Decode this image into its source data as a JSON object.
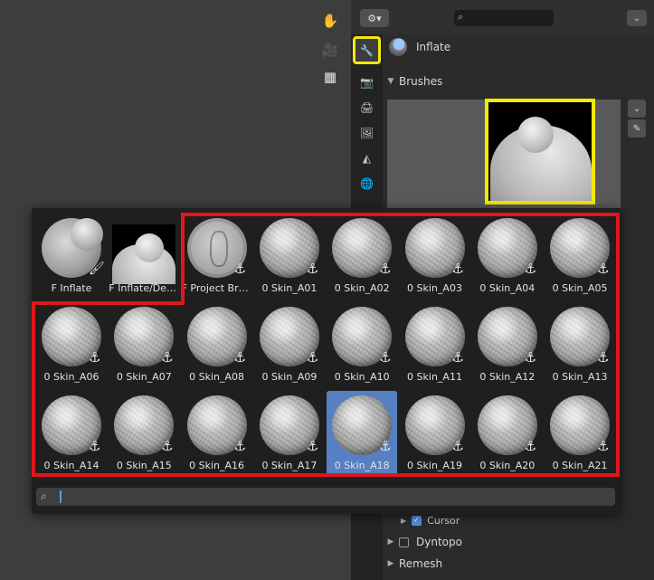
{
  "properties": {
    "brush_name": "Inflate",
    "brushes_panel_title": "Brushes",
    "panels": [
      {
        "label": "Cursor",
        "checked": true
      },
      {
        "label": "Dyntopo",
        "checked": false
      },
      {
        "label": "Remesh"
      }
    ]
  },
  "popup": {
    "items": [
      {
        "label": "F Inflate",
        "icon": "paint-brush-icon",
        "thumb": "inflate"
      },
      {
        "label": "F Inflate/Defl...",
        "icon": "",
        "thumb": "square"
      },
      {
        "label": "F Project Bru...",
        "icon": "anchor-icon",
        "thumb": "coin"
      },
      {
        "label": "0 Skin_A01",
        "icon": "anchor-icon",
        "thumb": "sphere"
      },
      {
        "label": "0 Skin_A02",
        "icon": "anchor-icon",
        "thumb": "sphere"
      },
      {
        "label": "0 Skin_A03",
        "icon": "anchor-icon",
        "thumb": "sphere"
      },
      {
        "label": "0 Skin_A04",
        "icon": "anchor-icon",
        "thumb": "sphere"
      },
      {
        "label": "0 Skin_A05",
        "icon": "anchor-icon",
        "thumb": "sphere"
      },
      {
        "label": "0 Skin_A06",
        "icon": "anchor-icon",
        "thumb": "sphere"
      },
      {
        "label": "0 Skin_A07",
        "icon": "anchor-icon",
        "thumb": "sphere"
      },
      {
        "label": "0 Skin_A08",
        "icon": "anchor-icon",
        "thumb": "sphere"
      },
      {
        "label": "0 Skin_A09",
        "icon": "anchor-icon",
        "thumb": "sphere"
      },
      {
        "label": "0 Skin_A10",
        "icon": "anchor-icon",
        "thumb": "sphere"
      },
      {
        "label": "0 Skin_A11",
        "icon": "anchor-icon",
        "thumb": "sphere"
      },
      {
        "label": "0 Skin_A12",
        "icon": "anchor-icon",
        "thumb": "sphere"
      },
      {
        "label": "0 Skin_A13",
        "icon": "anchor-icon",
        "thumb": "sphere"
      },
      {
        "label": "0 Skin_A14",
        "icon": "anchor-icon",
        "thumb": "sphere"
      },
      {
        "label": "0 Skin_A15",
        "icon": "anchor-icon",
        "thumb": "sphere"
      },
      {
        "label": "0 Skin_A16",
        "icon": "anchor-icon",
        "thumb": "sphere"
      },
      {
        "label": "0 Skin_A17",
        "icon": "anchor-icon",
        "thumb": "sphere"
      },
      {
        "label": "0 Skin_A18",
        "icon": "anchor-icon",
        "thumb": "sphere",
        "selected": true
      },
      {
        "label": "0 Skin_A19",
        "icon": "anchor-icon",
        "thumb": "sphere"
      },
      {
        "label": "0 Skin_A20",
        "icon": "anchor-icon",
        "thumb": "sphere"
      },
      {
        "label": "0 Skin_A21",
        "icon": "anchor-icon",
        "thumb": "sphere"
      }
    ],
    "search_value": ""
  },
  "colors": {
    "highlight_yellow": "#f5e90a",
    "highlight_red": "#e0161b",
    "selected_item": "#5680c2"
  }
}
